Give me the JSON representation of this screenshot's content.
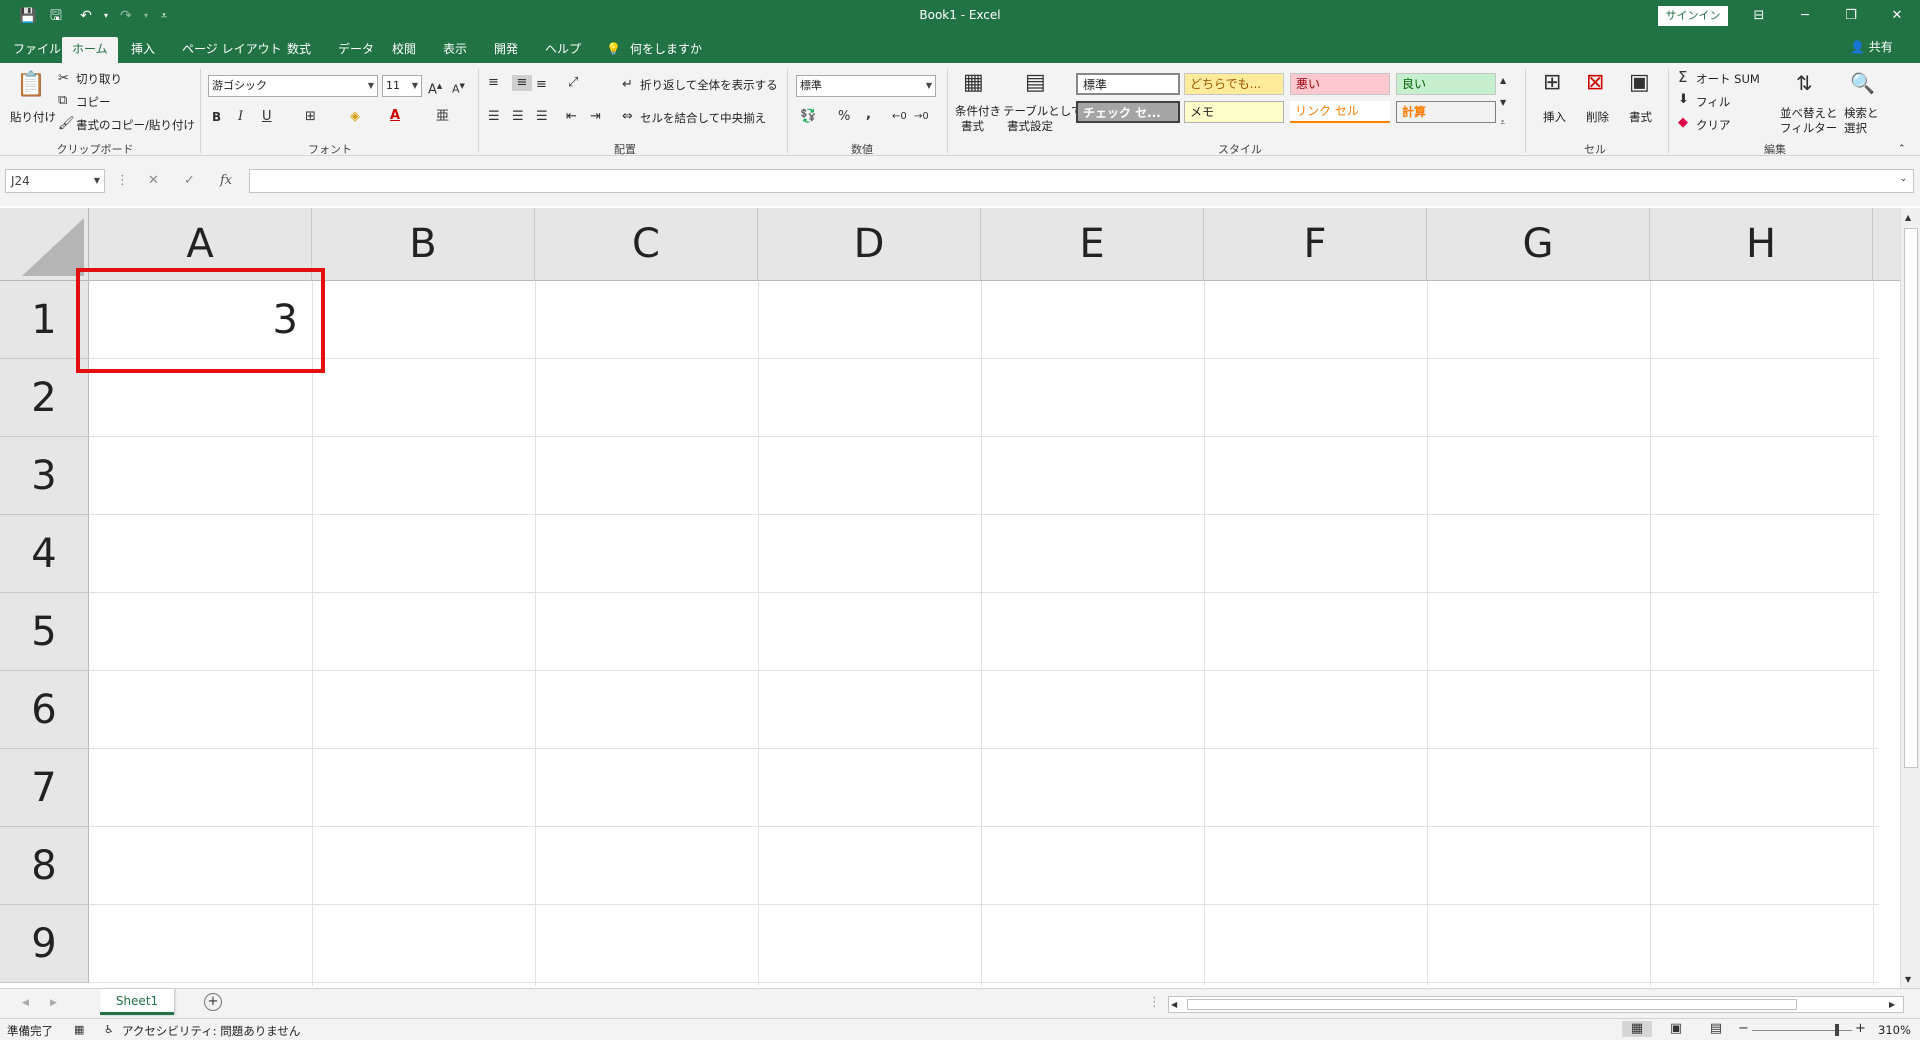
{
  "titlebar": {
    "title": "Book1  -  Excel",
    "signin": "サインイン",
    "min": "─",
    "restore": "❐",
    "close": "✕",
    "ribbon_display": "⊟"
  },
  "quick_access": {
    "autosave": "💾",
    "save": "🖫",
    "undo": "↶",
    "redo": "↷",
    "customize": "⩡"
  },
  "tabs": [
    "ファイル",
    "ホーム",
    "挿入",
    "ページ レイアウト",
    "数式",
    "データ",
    "校閲",
    "表示",
    "開発",
    "ヘルプ"
  ],
  "tell_me": "何をしますか",
  "share": "共有",
  "ribbon": {
    "clipboard": {
      "paste": "貼り付け",
      "cut": "切り取り",
      "copy": "コピー",
      "format_painter": "書式のコピー/貼り付け",
      "label": "クリップボード"
    },
    "font": {
      "font_name": "游ゴシック",
      "font_size": "11",
      "bold": "B",
      "italic": "I",
      "underline": "U",
      "label": "フォント"
    },
    "alignment": {
      "wrap_text": "折り返して全体を表示する",
      "merge_center": "セルを結合して中央揃え",
      "label": "配置"
    },
    "number": {
      "format": "標準",
      "percent": "%",
      "comma": ",",
      "label": "数値"
    },
    "styles": {
      "conditional_line1": "条件付き",
      "conditional_line2": "書式",
      "table_line1": "テーブルとして",
      "table_line2": "書式設定",
      "normal": "標準",
      "neutral": "どちらでも...",
      "bad": "悪い",
      "good": "良い",
      "check_cell": "チェック セ...",
      "memo": "メモ",
      "link_cell": "リンク セル",
      "calculation": "計算",
      "label": "スタイル"
    },
    "cells": {
      "insert": "挿入",
      "delete": "削除",
      "format": "書式",
      "label": "セル"
    },
    "editing": {
      "autosum": "オート SUM",
      "fill": "フィル",
      "clear": "クリア",
      "sort_line1": "並べ替えと",
      "sort_line2": "フィルター",
      "find_line1": "検索と",
      "find_line2": "選択",
      "label": "編集"
    }
  },
  "formula_bar": {
    "name_box": "J24",
    "cancel": "✕",
    "enter": "✓",
    "fx": "fx",
    "value": ""
  },
  "sheet": {
    "columns": [
      "A",
      "B",
      "C",
      "D",
      "E",
      "F",
      "G",
      "H"
    ],
    "rows": [
      "1",
      "2",
      "3",
      "4",
      "5",
      "6",
      "7",
      "8",
      "9"
    ],
    "cell_A1": "3",
    "highlight_color": "#e30f0f"
  },
  "sheet_tabs": {
    "active": "Sheet1",
    "add": "+"
  },
  "status": {
    "ready": "準備完了",
    "accessibility": "アクセシビリティ: 問題ありません",
    "zoom": "310%"
  },
  "colors": {
    "brand": "#217346",
    "ribbon_bg": "#f3f3f3"
  }
}
